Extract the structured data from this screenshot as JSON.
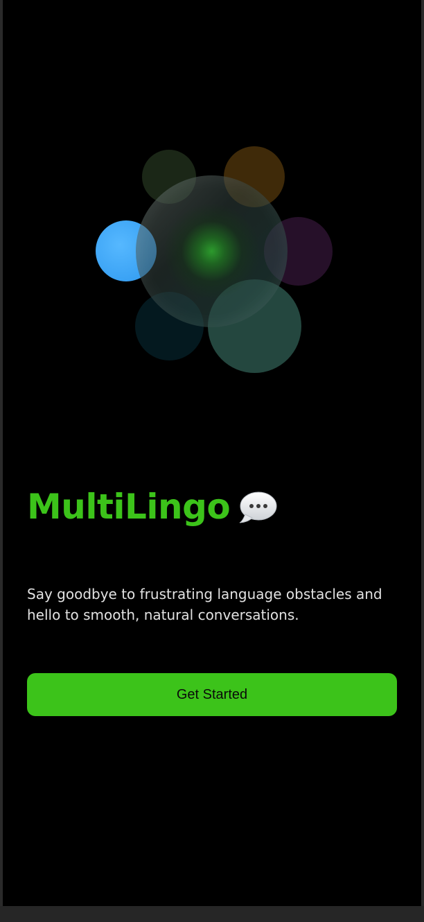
{
  "app": {
    "title": "MultiLingo"
  },
  "hero": {
    "icon": "chat-bubble-icon"
  },
  "tagline": "Say goodbye to frustrating language obstacles and hello to smooth, natural conversations.",
  "cta": {
    "label": "Get Started"
  },
  "colors": {
    "brand": "#3cc31a",
    "background": "#000000",
    "text": "#e2e2e2"
  }
}
